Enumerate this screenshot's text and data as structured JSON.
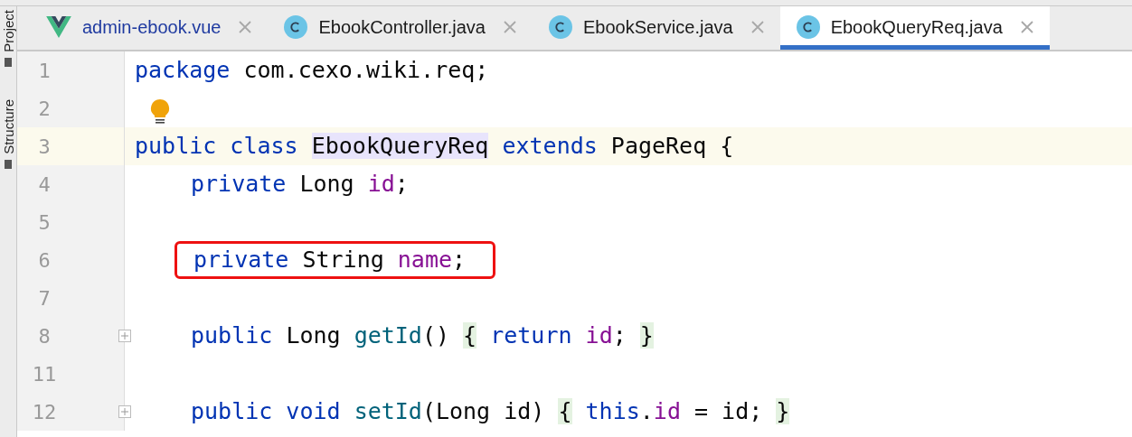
{
  "tool_windows": [
    {
      "label": "Project"
    },
    {
      "label": "Structure"
    }
  ],
  "tabs": [
    {
      "label": "admin-ebook.vue",
      "kind": "vue",
      "selected": false
    },
    {
      "label": "EbookController.java",
      "kind": "class",
      "selected": false
    },
    {
      "label": "EbookService.java",
      "kind": "class",
      "selected": false
    },
    {
      "label": "EbookQueryReq.java",
      "kind": "class",
      "selected": true
    }
  ],
  "lines": [
    {
      "number": "1",
      "current": false,
      "foldable": false,
      "bulb": false,
      "boxed": false,
      "indented": false,
      "tokens": [
        {
          "text": "package",
          "kind": "keyword",
          "spaced": false
        },
        {
          "text": "com.cexo.wiki.req;",
          "kind": "plain",
          "spaced": true
        }
      ]
    },
    {
      "number": "2",
      "current": false,
      "foldable": false,
      "bulb": true,
      "boxed": false
    },
    {
      "number": "3",
      "current": true,
      "foldable": false,
      "bulb": false,
      "boxed": false,
      "indented": false,
      "tokens": [
        {
          "text": "public class",
          "kind": "keyword",
          "spaced": false
        },
        {
          "text": "EbookQueryReq",
          "kind": "usage",
          "spaced": true
        },
        {
          "text": "extends",
          "kind": "keyword",
          "spaced": true
        },
        {
          "text": "PageReq {",
          "kind": "plain",
          "spaced": true
        }
      ]
    },
    {
      "number": "4",
      "current": false,
      "foldable": false,
      "bulb": false,
      "boxed": false,
      "indented": true,
      "tokens": [
        {
          "text": "private",
          "kind": "keyword",
          "spaced": false
        },
        {
          "text": "Long",
          "kind": "plain",
          "spaced": true
        },
        {
          "text": "id",
          "kind": "field",
          "spaced": true
        },
        {
          "text": ";",
          "kind": "plain",
          "spaced": false
        }
      ]
    },
    {
      "number": "5",
      "current": false,
      "foldable": false,
      "bulb": false,
      "boxed": false
    },
    {
      "number": "6",
      "current": false,
      "foldable": false,
      "bulb": false,
      "boxed": true,
      "indented": true,
      "tokens": [
        {
          "text": "private",
          "kind": "keyword",
          "spaced": false
        },
        {
          "text": "String",
          "kind": "plain",
          "spaced": true
        },
        {
          "text": "name",
          "kind": "field",
          "spaced": true
        },
        {
          "text": ";",
          "kind": "plain",
          "spaced": false
        }
      ]
    },
    {
      "number": "7",
      "current": false,
      "foldable": false,
      "bulb": false,
      "boxed": false
    },
    {
      "number": "8",
      "current": false,
      "foldable": true,
      "bulb": false,
      "boxed": false,
      "indented": true,
      "tokens": [
        {
          "text": "public",
          "kind": "keyword",
          "spaced": false
        },
        {
          "text": "Long",
          "kind": "plain",
          "spaced": true
        },
        {
          "text": "getId",
          "kind": "method",
          "spaced": true
        },
        {
          "text": "()",
          "kind": "plain",
          "spaced": false
        },
        {
          "text": "{",
          "kind": "brace",
          "spaced": true
        },
        {
          "text": "return",
          "kind": "keyword",
          "spaced": true
        },
        {
          "text": "id",
          "kind": "field",
          "spaced": true
        },
        {
          "text": ";",
          "kind": "plain",
          "spaced": false
        },
        {
          "text": "}",
          "kind": "brace",
          "spaced": true
        }
      ]
    },
    {
      "number": "11",
      "current": false,
      "foldable": false,
      "bulb": false,
      "boxed": false
    },
    {
      "number": "12",
      "current": false,
      "foldable": true,
      "bulb": false,
      "boxed": false,
      "indented": true,
      "tokens": [
        {
          "text": "public void",
          "kind": "keyword",
          "spaced": false
        },
        {
          "text": "setId",
          "kind": "method",
          "spaced": true
        },
        {
          "text": "(Long id)",
          "kind": "plain",
          "spaced": false
        },
        {
          "text": "{",
          "kind": "brace",
          "spaced": true
        },
        {
          "text": "this",
          "kind": "keyword",
          "spaced": true
        },
        {
          "text": ".",
          "kind": "plain",
          "spaced": false
        },
        {
          "text": "id",
          "kind": "field",
          "spaced": false
        },
        {
          "text": "= id;",
          "kind": "plain",
          "spaced": true
        },
        {
          "text": "}",
          "kind": "brace",
          "spaced": true
        }
      ]
    }
  ]
}
